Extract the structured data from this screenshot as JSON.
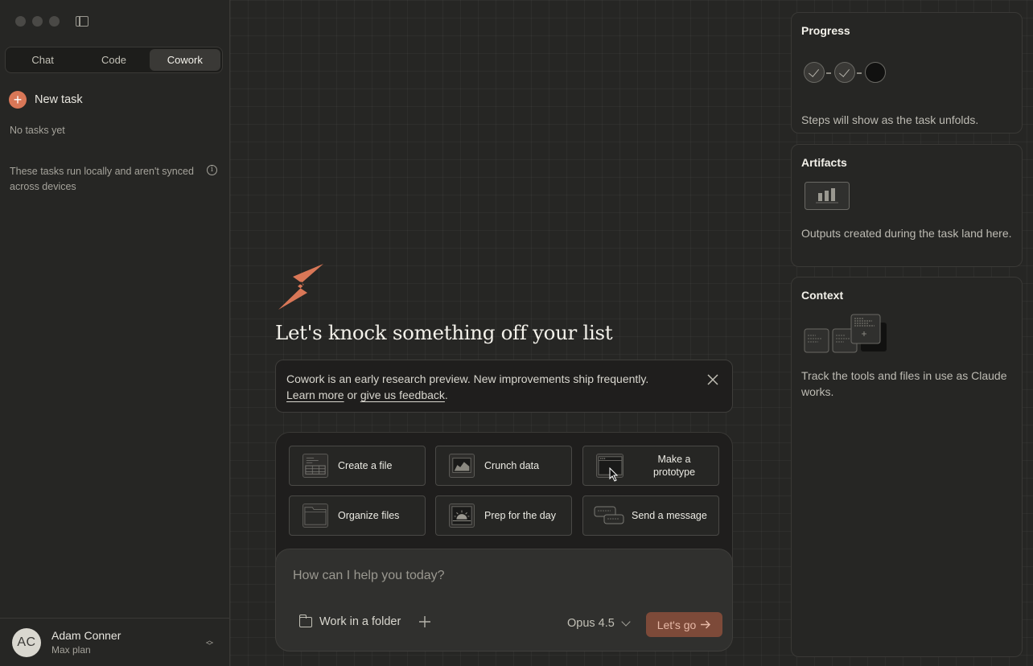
{
  "sidebar": {
    "modes": [
      {
        "label": "Chat",
        "active": false
      },
      {
        "label": "Code",
        "active": false
      },
      {
        "label": "Cowork",
        "active": true
      }
    ],
    "new_task_label": "New task",
    "empty_label": "No tasks yet",
    "local_note": "These tasks run locally and aren't synced across devices",
    "info_glyph": "i",
    "user": {
      "initials": "AC",
      "name": "Adam Conner",
      "plan": "Max plan"
    }
  },
  "main": {
    "headline": "Let's knock something off your list",
    "notice": {
      "text": "Cowork is an early research preview. New improvements ship frequently.",
      "learn_more": "Learn more",
      "or": " or ",
      "feedback": "give us feedback",
      "period": "."
    },
    "actions": [
      {
        "label": "Create a file",
        "icon": "file-spreadsheet-icon"
      },
      {
        "label": "Crunch data",
        "icon": "chart-icon"
      },
      {
        "label": "Make a prototype",
        "icon": "browser-window-icon"
      },
      {
        "label": "Organize files",
        "icon": "folder-icon"
      },
      {
        "label": "Prep for the day",
        "icon": "sunrise-icon"
      },
      {
        "label": "Send a message",
        "icon": "chat-bubbles-icon"
      }
    ],
    "input_placeholder": "How can I help you today?",
    "folder_label": "Work in a folder",
    "model_label": "Opus 4.5",
    "go_label": "Let's go"
  },
  "panel": {
    "progress": {
      "title": "Progress",
      "desc": "Steps will show as the task unfolds."
    },
    "artifacts": {
      "title": "Artifacts",
      "desc": "Outputs created during the task land here."
    },
    "context": {
      "title": "Context",
      "desc": "Track the tools and files in use as Claude works."
    }
  },
  "colors": {
    "accent": "#d97757",
    "background": "#262624",
    "go_button": "#7d4a39"
  }
}
